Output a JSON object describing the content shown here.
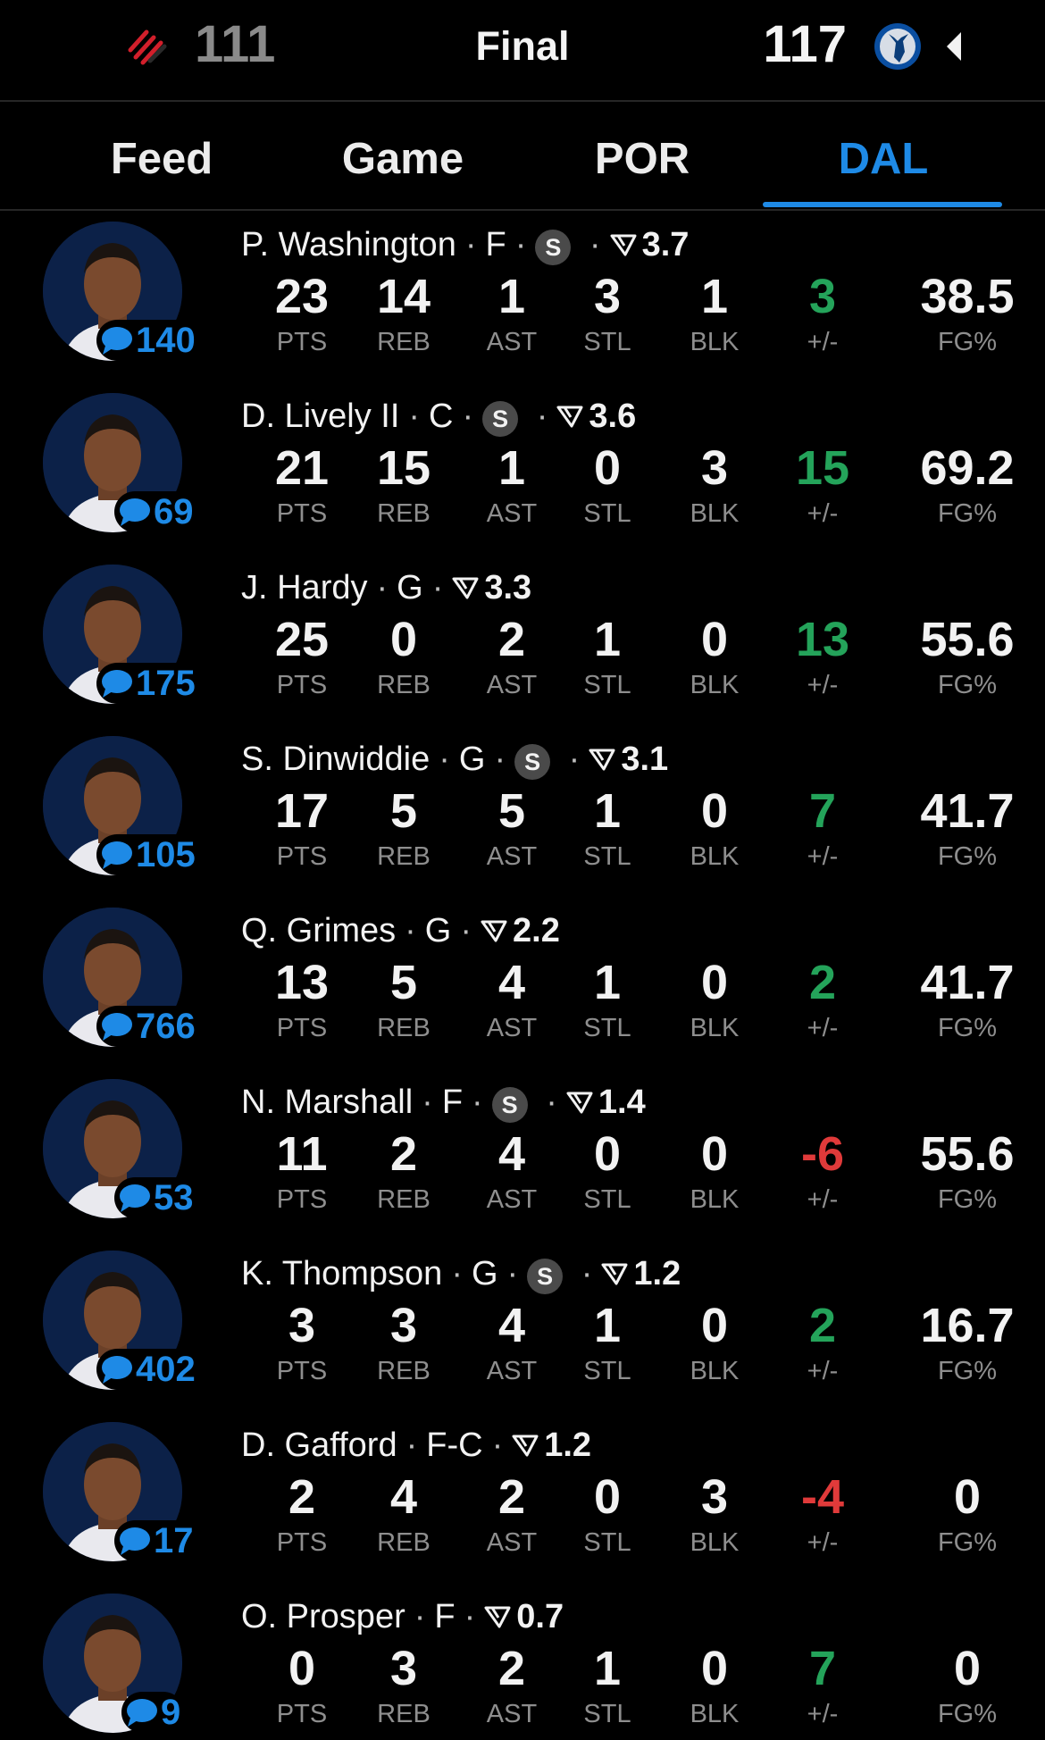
{
  "header": {
    "left_team": {
      "logo_icon": "trail-blazers-logo",
      "score": "111"
    },
    "status": "Final",
    "right_team": {
      "logo_icon": "mavericks-logo",
      "score": "117"
    },
    "collapse_icon": "triangle-left-icon"
  },
  "tabs": [
    {
      "label": "Feed",
      "active": false
    },
    {
      "label": "Game",
      "active": false
    },
    {
      "label": "POR",
      "active": false
    },
    {
      "label": "DAL",
      "active": true
    }
  ],
  "colors": {
    "accent": "#1e8ae6",
    "positive": "#24a35a",
    "negative": "#e03a3a",
    "avatar_bg": "#0c2148"
  },
  "stat_labels": [
    "PTS",
    "REB",
    "AST",
    "STL",
    "BLK",
    "+/-",
    "FG%"
  ],
  "players": [
    {
      "name": "P. Washington",
      "pos": "F",
      "starter": true,
      "rating": "3.7",
      "comments": "140",
      "stats": [
        "23",
        "14",
        "1",
        "3",
        "1",
        "3",
        "38.5"
      ],
      "pm_sign": "pos"
    },
    {
      "name": "D. Lively II",
      "pos": "C",
      "starter": true,
      "rating": "3.6",
      "comments": "69",
      "stats": [
        "21",
        "15",
        "1",
        "0",
        "3",
        "15",
        "69.2"
      ],
      "pm_sign": "pos"
    },
    {
      "name": "J. Hardy",
      "pos": "G",
      "starter": false,
      "rating": "3.3",
      "comments": "175",
      "stats": [
        "25",
        "0",
        "2",
        "1",
        "0",
        "13",
        "55.6"
      ],
      "pm_sign": "pos"
    },
    {
      "name": "S. Dinwiddie",
      "pos": "G",
      "starter": true,
      "rating": "3.1",
      "comments": "105",
      "stats": [
        "17",
        "5",
        "5",
        "1",
        "0",
        "7",
        "41.7"
      ],
      "pm_sign": "pos"
    },
    {
      "name": "Q. Grimes",
      "pos": "G",
      "starter": false,
      "rating": "2.2",
      "comments": "766",
      "stats": [
        "13",
        "5",
        "4",
        "1",
        "0",
        "2",
        "41.7"
      ],
      "pm_sign": "pos"
    },
    {
      "name": "N. Marshall",
      "pos": "F",
      "starter": true,
      "rating": "1.4",
      "comments": "53",
      "stats": [
        "11",
        "2",
        "4",
        "0",
        "0",
        "-6",
        "55.6"
      ],
      "pm_sign": "neg"
    },
    {
      "name": "K. Thompson",
      "pos": "G",
      "starter": true,
      "rating": "1.2",
      "comments": "402",
      "stats": [
        "3",
        "3",
        "4",
        "1",
        "0",
        "2",
        "16.7"
      ],
      "pm_sign": "pos"
    },
    {
      "name": "D. Gafford",
      "pos": "F-C",
      "starter": false,
      "rating": "1.2",
      "comments": "17",
      "stats": [
        "2",
        "4",
        "2",
        "0",
        "3",
        "-4",
        "0"
      ],
      "pm_sign": "neg"
    },
    {
      "name": "O. Prosper",
      "pos": "F",
      "starter": false,
      "rating": "0.7",
      "comments": "9",
      "stats": [
        "0",
        "3",
        "2",
        "1",
        "0",
        "7",
        "0"
      ],
      "pm_sign": "pos"
    }
  ],
  "starter_badge_label": "S",
  "icons": {
    "comment": "comment-bubble-icon",
    "rating": "rating-funnel-icon",
    "avatar": "player-headshot"
  }
}
